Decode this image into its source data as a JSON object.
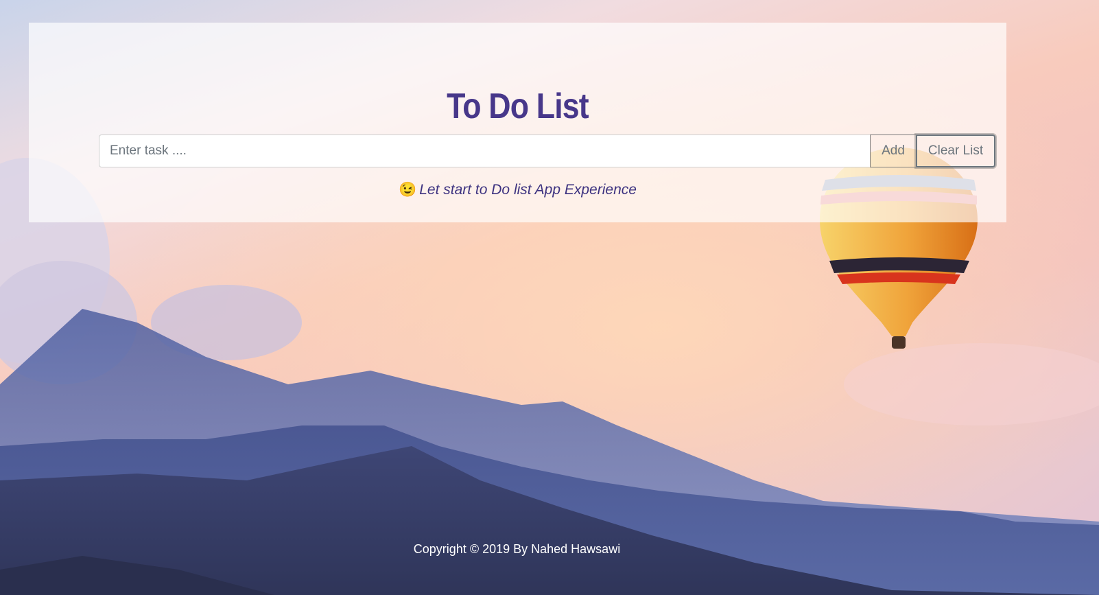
{
  "app": {
    "title": "To Do List"
  },
  "form": {
    "task_placeholder": "Enter task ....",
    "task_value": "",
    "add_label": "Add",
    "clear_label": "Clear List"
  },
  "message": {
    "emoji": "😉",
    "text": "Let start to Do list App Experience"
  },
  "footer": {
    "copyright": "Copyright © 2019 By Nahed Hawsawi"
  },
  "colors": {
    "accent": "#47378a",
    "message_text": "#3d3280",
    "footer_text": "#ffffff"
  }
}
